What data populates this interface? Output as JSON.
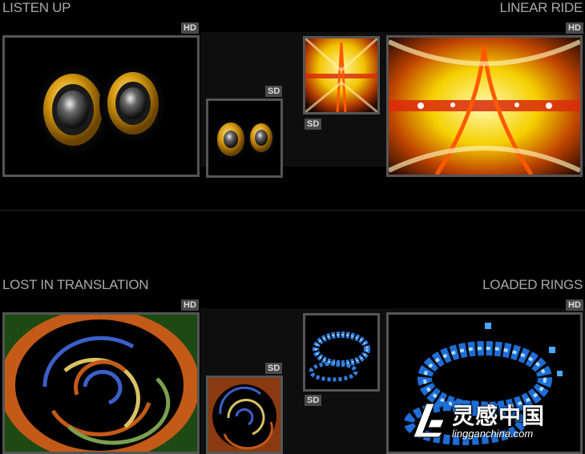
{
  "sections": [
    {
      "title": "LISTEN UP",
      "hd_badge": "HD",
      "sd_badge": "SD"
    },
    {
      "title": "LINEAR RIDE",
      "hd_badge": "HD",
      "sd_badge": "SD"
    },
    {
      "title": "LOST IN TRANSLATION",
      "hd_badge": "HD",
      "sd_badge": "SD"
    },
    {
      "title": "LOADED RINGS",
      "hd_badge": "HD",
      "sd_badge": "SD"
    }
  ],
  "watermark": {
    "brand": "灵感中国",
    "url": "lingganchina.com"
  },
  "colors": {
    "background": "#000000",
    "panel": "#131313",
    "badge": "#4a4a4a",
    "title_text": "#a9a9a9",
    "frame": "#555555"
  },
  "icons": {
    "speakers": "speaker-pair-image",
    "tunnel": "light-tunnel-image",
    "rings": "concentric-rings-image",
    "cubes": "blue-cube-rings-image"
  }
}
